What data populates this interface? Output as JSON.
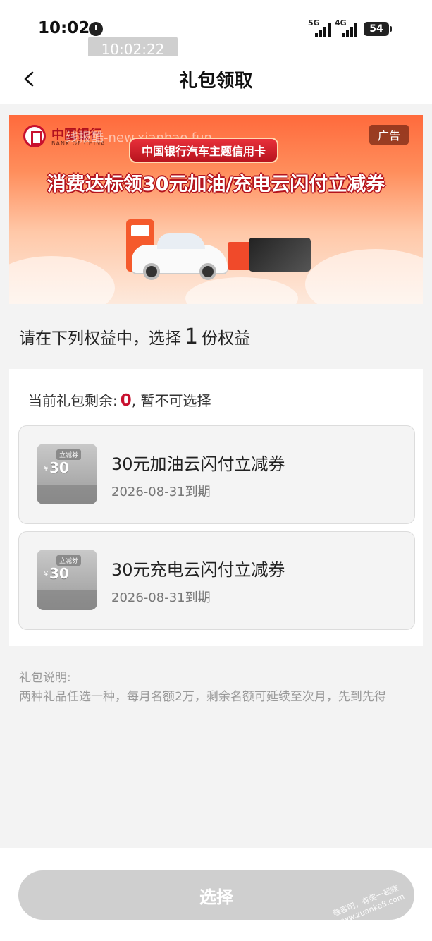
{
  "status_bar": {
    "time": "10:02",
    "time_overlay": "10:02:22",
    "network_1": "5G",
    "network_2": "4G",
    "battery": "54"
  },
  "navbar": {
    "title": "礼包领取"
  },
  "banner": {
    "bank_name": "中国银行",
    "bank_name_en": "BANK OF CHINA",
    "watermark": "线报酷-new.xianbao.fun",
    "ad_label": "广告",
    "card_title": "中国银行汽车主题信用卡",
    "headline": "消费达标领30元加油/充电云闪付立减券"
  },
  "instruction": {
    "prefix": "请在下列权益中，选择",
    "count": "1",
    "suffix": "份权益"
  },
  "package": {
    "remain_label": "当前礼包剩余:",
    "remain_count": "0",
    "remain_suffix": ", 暂不可选择"
  },
  "options": [
    {
      "title": "30元加油云闪付立减券",
      "expiry": "2026-08-31到期",
      "thumb_tag": "立减券",
      "thumb_amount": "30",
      "thumb_currency": "¥"
    },
    {
      "title": "30元充电云闪付立减券",
      "expiry": "2026-08-31到期",
      "thumb_tag": "立减券",
      "thumb_amount": "30",
      "thumb_currency": "¥"
    }
  ],
  "notes": {
    "title": "礼包说明:",
    "body": "两种礼品任选一种，每月名额2万，剩余名额可延续至次月，先到先得"
  },
  "footer": {
    "button_label": "选择",
    "watermark": "赚客吧，有奖一起赚 www.zuanke8.com"
  }
}
